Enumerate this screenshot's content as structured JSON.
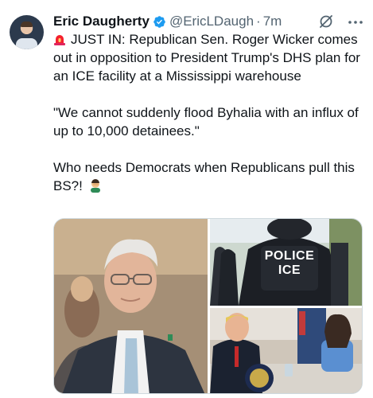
{
  "tweet": {
    "author": {
      "name": "Eric Daugherty",
      "handle": "@EricLDaugh",
      "separator": "·",
      "time": "7m",
      "verified_color": "#1d9bf0"
    },
    "text": {
      "line1": "JUST IN: Republican Sen. Roger Wicker comes out in opposition to President Trump's DHS plan for an ICE facility at a Mississippi warehouse",
      "line2": "\"We cannot suddenly flood Byhalia with an influx of up to 10,000 detainees.\"",
      "line3": "Who needs Democrats when Republicans pull this BS?!"
    },
    "media": {
      "photo_police_text": "POLICE ICE"
    },
    "icons": [
      "siren-emoji",
      "verified-badge",
      "grok-icon",
      "more-icon",
      "facepalm-emoji"
    ],
    "colors": {
      "text": "#0f1419",
      "muted": "#536471",
      "accent": "#1d9bf0"
    }
  }
}
